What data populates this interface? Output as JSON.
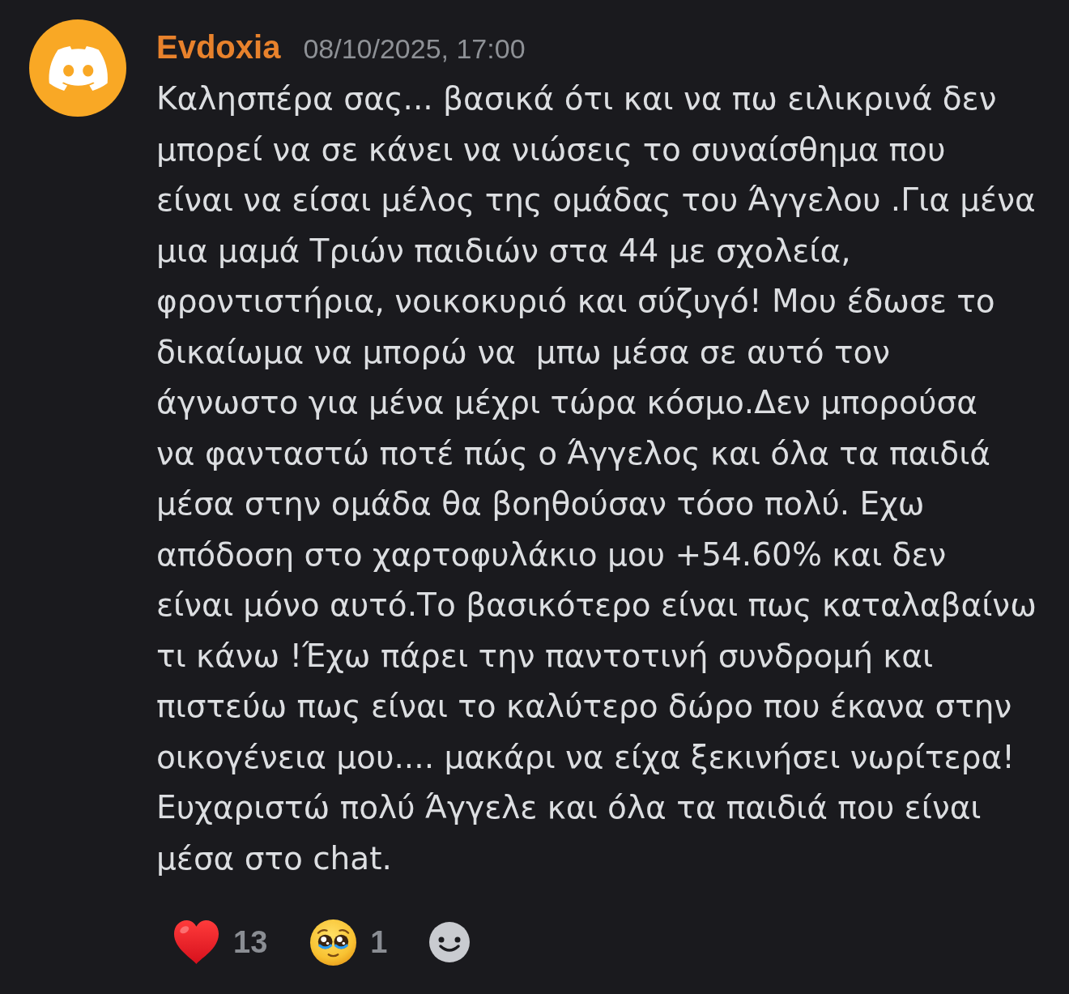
{
  "message": {
    "author": "Evdoxia",
    "timestamp": "08/10/2025, 17:00",
    "text": "Καλησπέρα σας... βασικά ότι και να πω ειλικρινά δεν\nμπορεί να σε κάνει να νιώσεις το συναίσθημα που\nείναι να είσαι μέλος της ομάδας του Άγγελου .Για μένα\nμια μαμά Τριών παιδιών στα 44 με σχολεία,\nφροντιστήρια, νοικοκυριό και σύζυγό! Μου έδωσε το\nδικαίωμα να μπορώ να  μπω μέσα σε αυτό τον\nάγνωστο για μένα μέχρι τώρα κόσμο.Δεν μπορούσα\nνα φανταστώ ποτέ πώς ο Άγγελος και όλα τα παιδιά\nμέσα στην ομάδα θα βοηθούσαν τόσο πολύ. Εχω\nαπόδοση στο χαρτοφυλάκιο μου +54.60% και δεν\nείναι μόνο αυτό.Το βασικότερο είναι πως καταλαβαίνω\nτι κάνω !Έχω πάρει την παντοτινή συνδρομή και\nπιστεύω πως είναι το καλύτερο δώρο που έκανα στην\nοικογένεια μου.... μακάρι να είχα ξεκινήσει νωρίτερα!\nΕυχαριστώ πολύ Άγγελε και όλα τα παιδιά που είναι\nμέσα στο chat."
  },
  "reactions": [
    {
      "kind": "heart",
      "count": "13"
    },
    {
      "kind": "pleading-face",
      "count": "1"
    }
  ]
}
